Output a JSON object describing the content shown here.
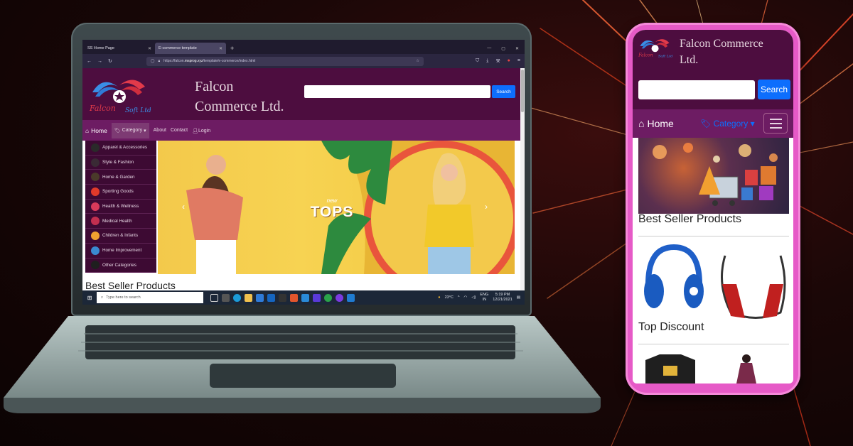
{
  "laptop": {
    "browser": {
      "tabs": [
        {
          "label": "SS Home Page",
          "active": false
        },
        {
          "label": "E-commerce template",
          "active": true
        }
      ],
      "url_prefix": "https://falcon.",
      "url_domain": "msprog.xyz",
      "url_path": "/template/e-commerce/index.html"
    },
    "site": {
      "title_line1": "Falcon",
      "title_line2": "Commerce Ltd.",
      "search_label": "Search",
      "nav": {
        "home": "Home",
        "category": "Category",
        "about": "About",
        "contact": "Contact",
        "login": "Login"
      },
      "categories": [
        {
          "label": "Apparel & Accessories",
          "color": "#2a2a2a"
        },
        {
          "label": "Style & Fashion",
          "color": "#3a2a35"
        },
        {
          "label": "Home & Garden",
          "color": "#4a3a2a"
        },
        {
          "label": "Sporting Goods",
          "color": "#e03a2a"
        },
        {
          "label": "Health & Wellness",
          "color": "#d93a5a"
        },
        {
          "label": "Medical Health",
          "color": "#c22f4f"
        },
        {
          "label": "Children & Infants",
          "color": "#f0a030"
        },
        {
          "label": "Home Improvement",
          "color": "#3a8ad0"
        },
        {
          "label": "Other Categories",
          "color": "#1f1f1f"
        }
      ],
      "hero": {
        "new": "new",
        "tops": "TOPS"
      },
      "section_title": "Best Seller Products"
    },
    "taskbar": {
      "search_placeholder": "Type here to search",
      "weather": "23°C",
      "lang1": "ENG",
      "lang2": "IN",
      "time": "5:19 PM",
      "date": "12/21/2021"
    }
  },
  "phone": {
    "title_line1": "Falcon Commerce",
    "title_line2": "Ltd.",
    "search_label": "Search",
    "nav": {
      "home": "Home",
      "category": "Category"
    },
    "sections": [
      "Best Seller Products",
      "Top Discount"
    ]
  },
  "colors": {
    "header": "#4d0d3f",
    "nav": "#6d1c63",
    "search_button": "#0d6efd",
    "phone_frame": "#e65ac7"
  }
}
